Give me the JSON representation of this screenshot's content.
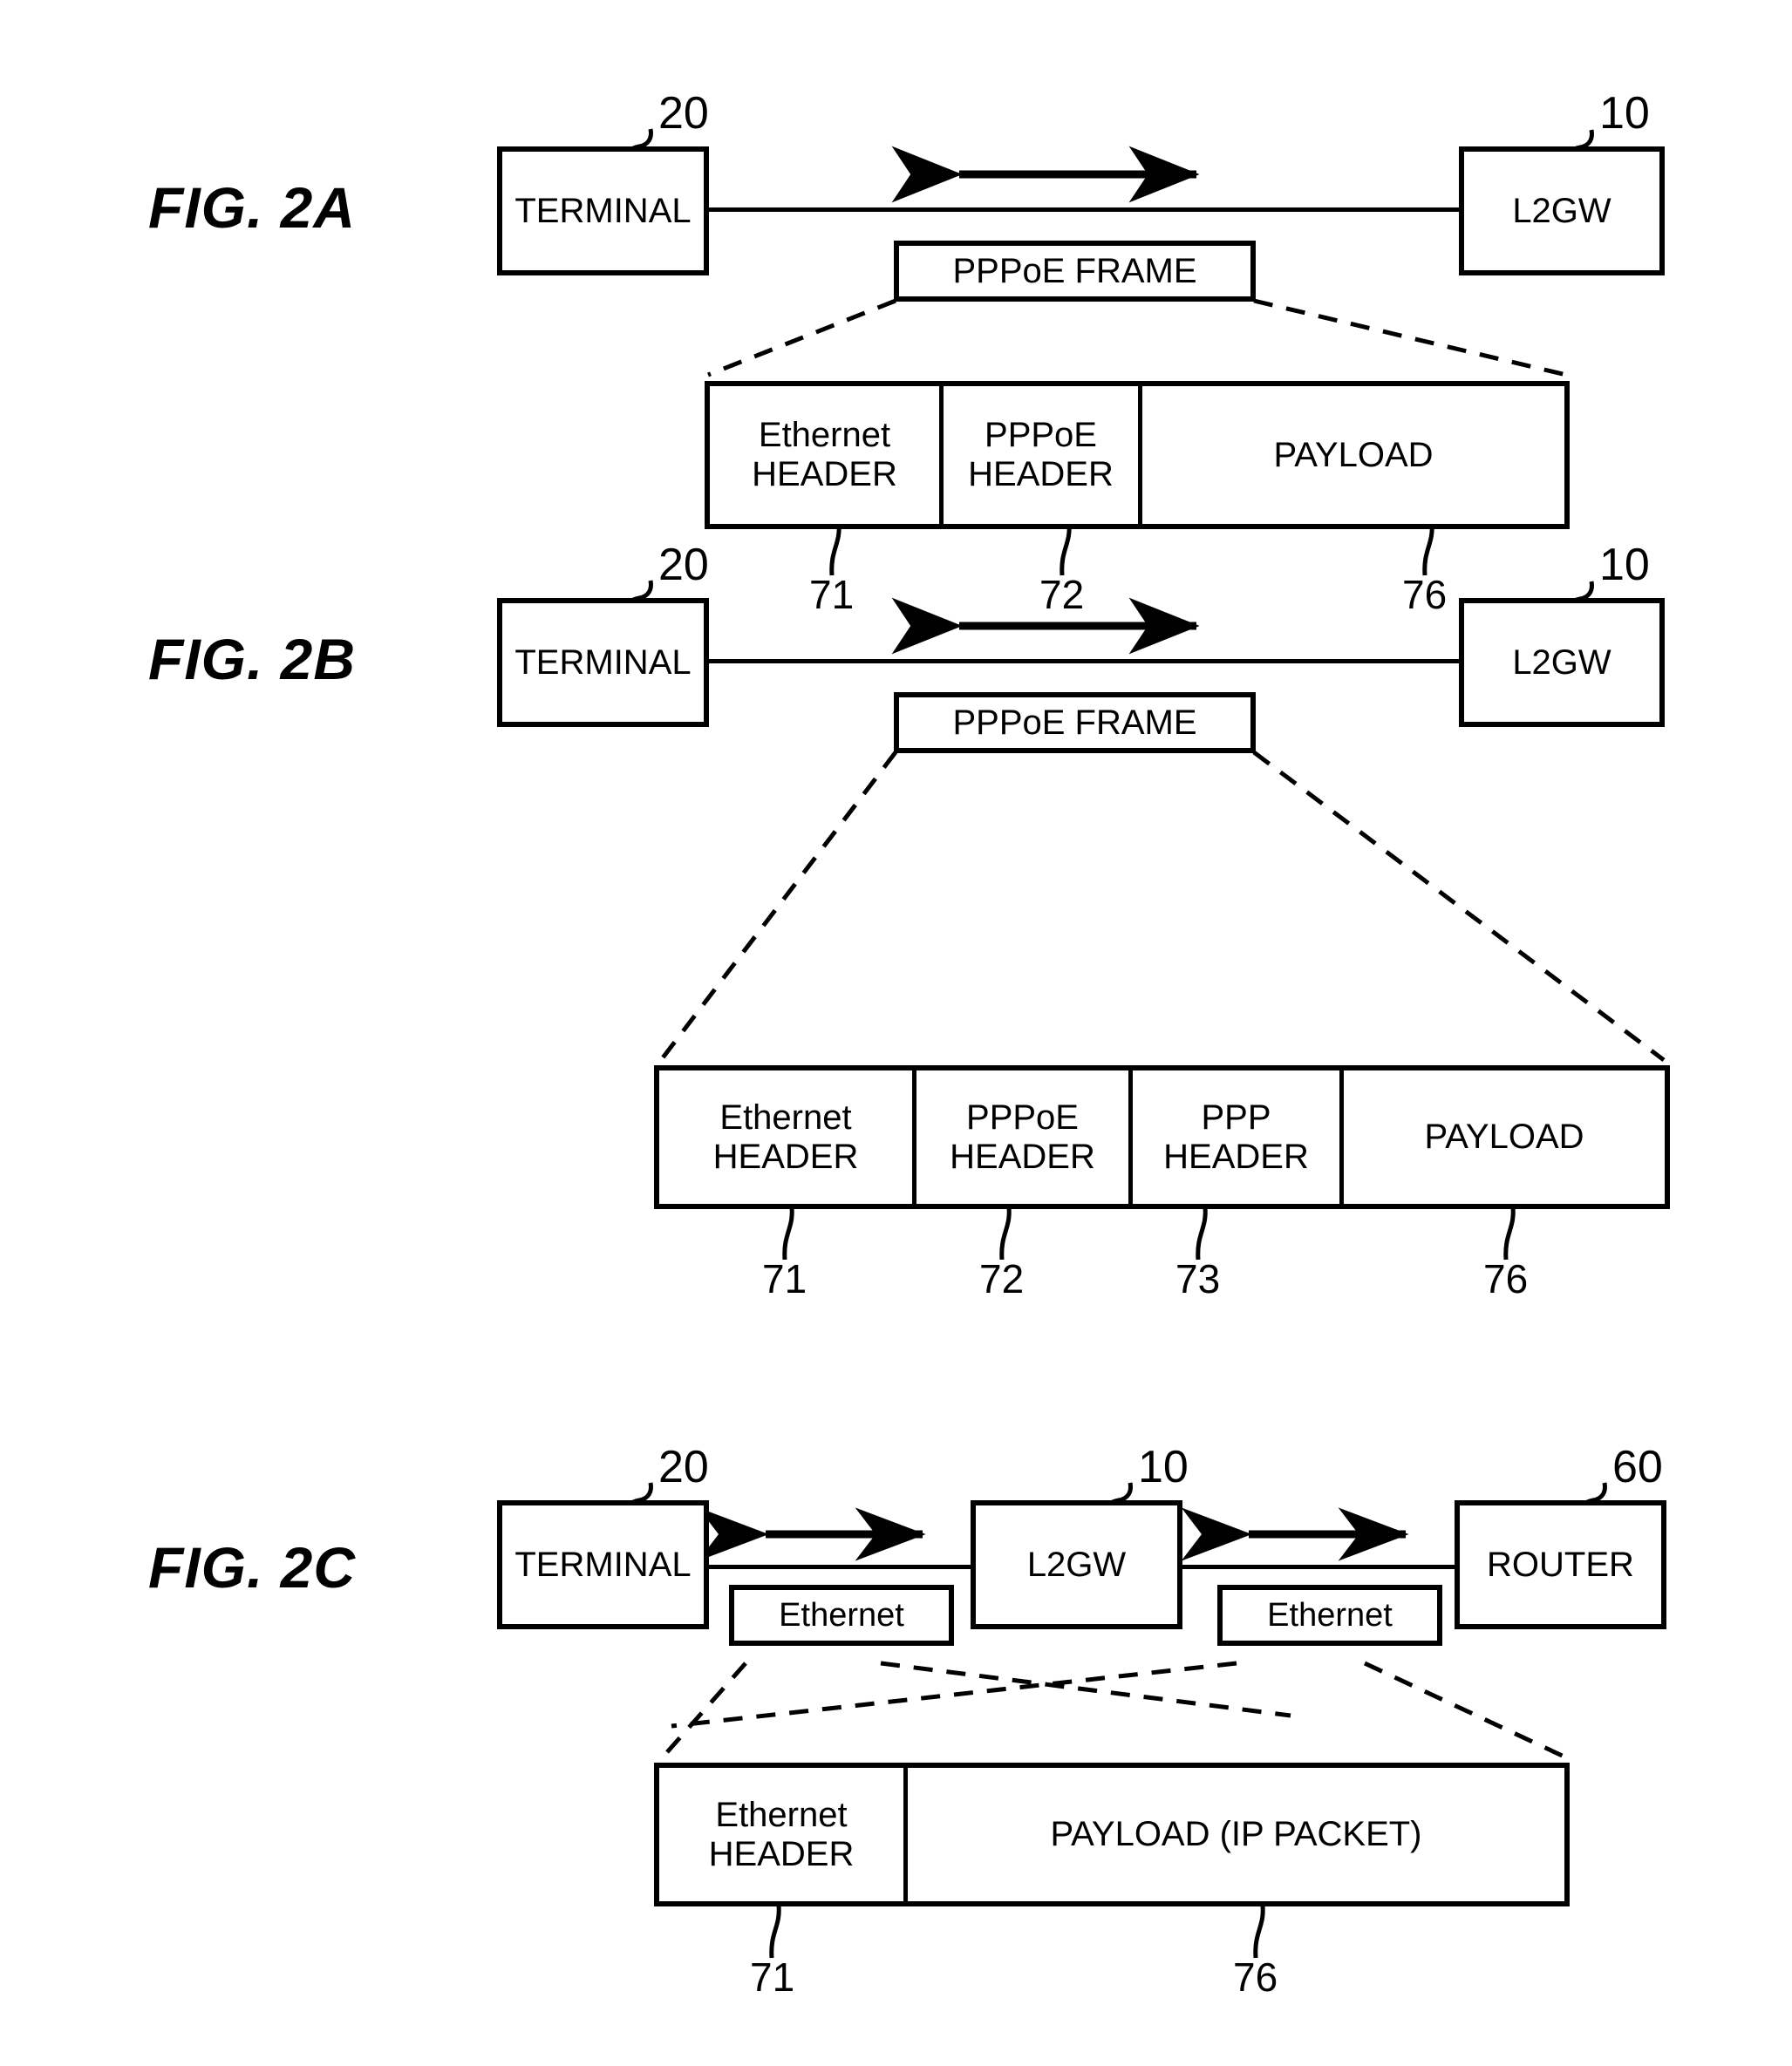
{
  "figures": [
    {
      "id": "2a",
      "label": "FIG. 2A",
      "nodes": [
        {
          "name": "terminal",
          "label": "TERMINAL",
          "ref": "20"
        },
        {
          "name": "l2gw",
          "label": "L2GW",
          "ref": "10"
        }
      ],
      "callouts": [
        {
          "name": "pppoe-frame",
          "label": "PPPoE FRAME"
        }
      ],
      "packet": {
        "cells": [
          {
            "line1": "Ethernet",
            "line2": "HEADER",
            "ref": "71"
          },
          {
            "line1": "PPPoE",
            "line2": "HEADER",
            "ref": "72"
          },
          {
            "line1": "PAYLOAD",
            "line2": "",
            "ref": "76"
          }
        ]
      }
    },
    {
      "id": "2b",
      "label": "FIG. 2B",
      "nodes": [
        {
          "name": "terminal",
          "label": "TERMINAL",
          "ref": "20"
        },
        {
          "name": "l2gw",
          "label": "L2GW",
          "ref": "10"
        }
      ],
      "callouts": [
        {
          "name": "pppoe-frame",
          "label": "PPPoE FRAME"
        }
      ],
      "packet": {
        "cells": [
          {
            "line1": "Ethernet",
            "line2": "HEADER",
            "ref": "71"
          },
          {
            "line1": "PPPoE",
            "line2": "HEADER",
            "ref": "72"
          },
          {
            "line1": "PPP",
            "line2": "HEADER",
            "ref": "73"
          },
          {
            "line1": "PAYLOAD",
            "line2": "",
            "ref": "76"
          }
        ]
      }
    },
    {
      "id": "2c",
      "label": "FIG. 2C",
      "nodes": [
        {
          "name": "terminal",
          "label": "TERMINAL",
          "ref": "20"
        },
        {
          "name": "l2gw",
          "label": "L2GW",
          "ref": "10"
        },
        {
          "name": "router",
          "label": "ROUTER",
          "ref": "60"
        }
      ],
      "callouts": [
        {
          "name": "ethernet-left",
          "label": "Ethernet"
        },
        {
          "name": "ethernet-right",
          "label": "Ethernet"
        }
      ],
      "packet": {
        "cells": [
          {
            "line1": "Ethernet",
            "line2": "HEADER",
            "ref": "71"
          },
          {
            "line1": "PAYLOAD (IP PACKET)",
            "line2": "",
            "ref": "76"
          }
        ]
      }
    }
  ],
  "colors": {
    "ink": "#000000",
    "paper": "#ffffff"
  }
}
